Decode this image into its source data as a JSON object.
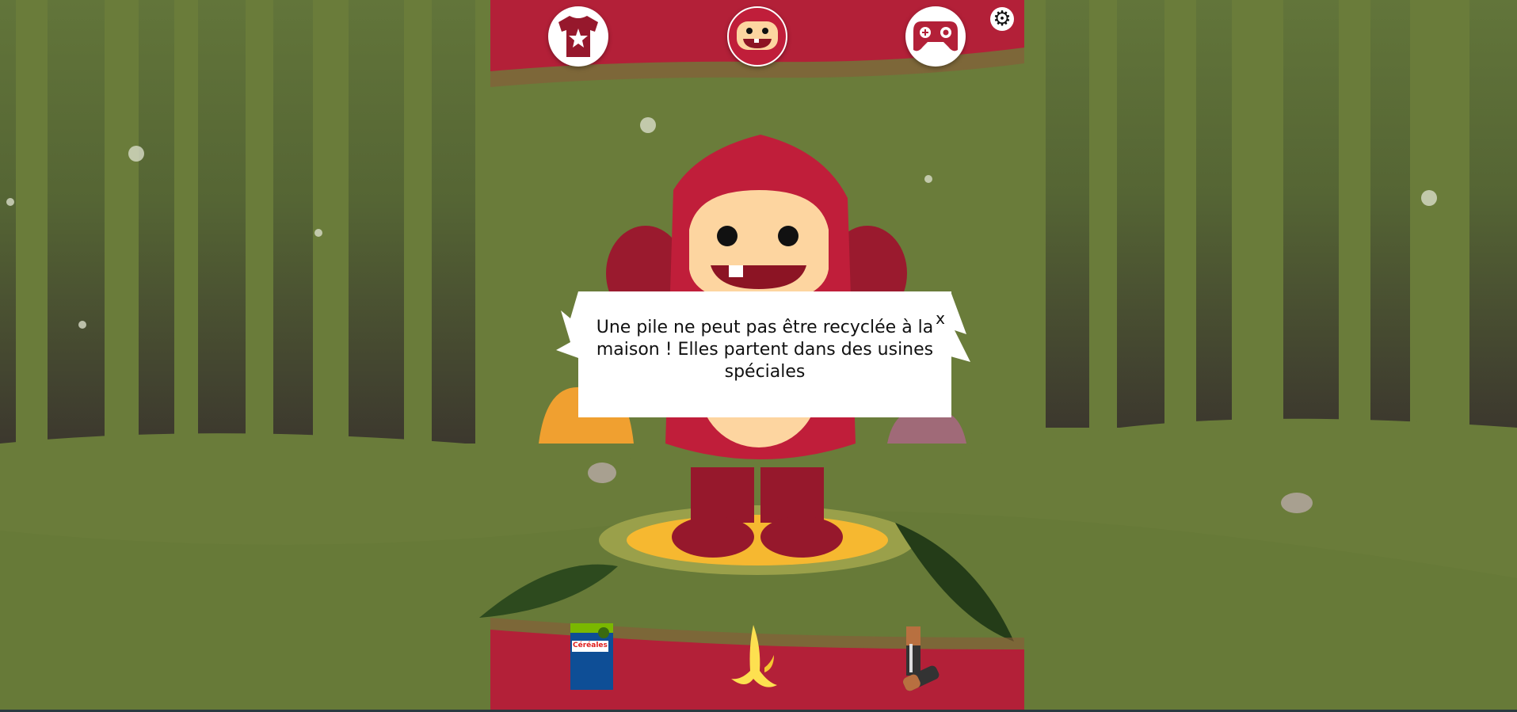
{
  "top_menu": {
    "items": [
      {
        "name": "wardrobe",
        "icon": "tshirt-star-icon"
      },
      {
        "name": "character",
        "icon": "monster-face-icon"
      },
      {
        "name": "games",
        "icon": "gamepad-icon"
      }
    ],
    "settings_icon": "gear-icon"
  },
  "dialog": {
    "message": "Une pile ne peut pas être recyclée à la maison ! Elles partent dans des usines spéciales",
    "close_label": "x"
  },
  "items_bar": {
    "items": [
      {
        "name": "cereal-box",
        "label": "Céréales"
      },
      {
        "name": "banana-peel"
      },
      {
        "name": "batteries"
      }
    ]
  },
  "colors": {
    "bar_red": "#b32038",
    "forest_green": "#6a7c3a",
    "monster_red": "#c01e3a",
    "skin": "#fdd5a0"
  }
}
